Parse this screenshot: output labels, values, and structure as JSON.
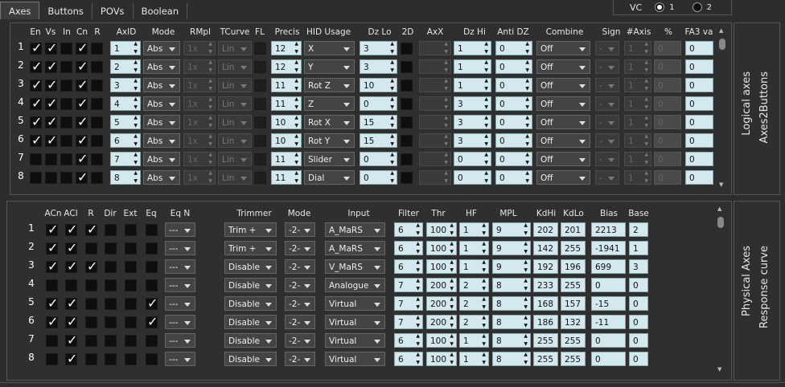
{
  "tabs": [
    "Axes",
    "Buttons",
    "POVs",
    "Boolean"
  ],
  "vc": {
    "label": "VC",
    "opt1": "1",
    "opt2": "2"
  },
  "side": {
    "top_a": "Logical axes",
    "top_b": "Axes2Buttons",
    "bot_a": "Physical Axes",
    "bot_b": "Response curve"
  },
  "logical": {
    "headers": [
      "En",
      "Vs",
      "In",
      "Cn",
      "R",
      "AxID",
      "Mode",
      "RMpl",
      "TCurve",
      "FL",
      "Precis",
      "HID Usage",
      "Dz Lo",
      "2D",
      "AxX",
      "Dz Hi",
      "Anti DZ",
      "Combine",
      "Sign",
      "#Axis",
      "%",
      "FA3 va"
    ],
    "rows": [
      {
        "n": "1",
        "en": 1,
        "vs": 1,
        "in": 0,
        "cn": 1,
        "r": 0,
        "axid": "1",
        "mode": "Abs",
        "rmpl": "1x",
        "tcurve": "Lin",
        "precis": "12",
        "hid": "X",
        "dzlo": "3",
        "dzhi": "1",
        "antidz": "0",
        "combine": "Off",
        "sign": "-",
        "naxis": "1",
        "pct": "0",
        "fa3": "0"
      },
      {
        "n": "2",
        "en": 1,
        "vs": 1,
        "in": 0,
        "cn": 1,
        "r": 0,
        "axid": "2",
        "mode": "Abs",
        "rmpl": "1x",
        "tcurve": "Lin",
        "precis": "12",
        "hid": "Y",
        "dzlo": "3",
        "dzhi": "1",
        "antidz": "0",
        "combine": "Off",
        "sign": "-",
        "naxis": "1",
        "pct": "0",
        "fa3": "0"
      },
      {
        "n": "3",
        "en": 1,
        "vs": 1,
        "in": 0,
        "cn": 1,
        "r": 0,
        "axid": "3",
        "mode": "Abs",
        "rmpl": "1x",
        "tcurve": "Lin",
        "precis": "11",
        "hid": "Rot Z",
        "dzlo": "10",
        "dzhi": "1",
        "antidz": "0",
        "combine": "Off",
        "sign": "-",
        "naxis": "1",
        "pct": "0",
        "fa3": "0"
      },
      {
        "n": "4",
        "en": 1,
        "vs": 1,
        "in": 0,
        "cn": 1,
        "r": 0,
        "axid": "4",
        "mode": "Abs",
        "rmpl": "1x",
        "tcurve": "Lin",
        "precis": "11",
        "hid": "Z",
        "dzlo": "0",
        "dzhi": "3",
        "antidz": "0",
        "combine": "Off",
        "sign": "-",
        "naxis": "1",
        "pct": "0",
        "fa3": "0"
      },
      {
        "n": "5",
        "en": 1,
        "vs": 1,
        "in": 0,
        "cn": 1,
        "r": 0,
        "axid": "5",
        "mode": "Abs",
        "rmpl": "1x",
        "tcurve": "Lin",
        "precis": "10",
        "hid": "Rot X",
        "dzlo": "15",
        "dzhi": "3",
        "antidz": "0",
        "combine": "Off",
        "sign": "-",
        "naxis": "1",
        "pct": "0",
        "fa3": "0"
      },
      {
        "n": "6",
        "en": 1,
        "vs": 1,
        "in": 0,
        "cn": 1,
        "r": 0,
        "axid": "6",
        "mode": "Abs",
        "rmpl": "1x",
        "tcurve": "Lin",
        "precis": "10",
        "hid": "Rot Y",
        "dzlo": "15",
        "dzhi": "3",
        "antidz": "0",
        "combine": "Off",
        "sign": "-",
        "naxis": "1",
        "pct": "0",
        "fa3": "0"
      },
      {
        "n": "7",
        "en": 0,
        "vs": 0,
        "in": 0,
        "cn": 1,
        "r": 0,
        "axid": "7",
        "mode": "Abs",
        "rmpl": "1x",
        "tcurve": "Lin",
        "precis": "11",
        "hid": "Slider",
        "dzlo": "0",
        "dzhi": "0",
        "antidz": "0",
        "combine": "Off",
        "sign": "-",
        "naxis": "1",
        "pct": "0",
        "fa3": "0"
      },
      {
        "n": "8",
        "en": 0,
        "vs": 0,
        "in": 0,
        "cn": 1,
        "r": 0,
        "axid": "8",
        "mode": "Abs",
        "rmpl": "1x",
        "tcurve": "Lin",
        "precis": "11",
        "hid": "Dial",
        "dzlo": "0",
        "dzhi": "0",
        "antidz": "0",
        "combine": "Off",
        "sign": "-",
        "naxis": "1",
        "pct": "0",
        "fa3": "0"
      }
    ]
  },
  "physical": {
    "headers": [
      "ACn",
      "ACl",
      "R",
      "Dir",
      "Ext",
      "Eq",
      "Eq N",
      "Trimmer",
      "Mode",
      "Input",
      "Filter",
      "Thr",
      "HF",
      "MPL",
      "KdHi",
      "KdLo",
      "Bias",
      "Base"
    ],
    "rows": [
      {
        "n": "1",
        "acn": 1,
        "acl": 1,
        "r": 1,
        "dir": 0,
        "ext": 0,
        "eq": 0,
        "eqn": "---",
        "trim": "Trim +",
        "mode": "-2-",
        "input": "A_MaRS",
        "filter": "6",
        "thr": "100",
        "hf": "1",
        "mpl": "9",
        "kdhi": "202",
        "kdlo": "201",
        "bias": "2213",
        "base": "2"
      },
      {
        "n": "2",
        "acn": 1,
        "acl": 1,
        "r": 0,
        "dir": 0,
        "ext": 0,
        "eq": 0,
        "eqn": "---",
        "trim": "Trim +",
        "mode": "-2-",
        "input": "A_MaRS",
        "filter": "6",
        "thr": "100",
        "hf": "1",
        "mpl": "9",
        "kdhi": "142",
        "kdlo": "255",
        "bias": "-1941",
        "base": "1"
      },
      {
        "n": "3",
        "acn": 1,
        "acl": 1,
        "r": 1,
        "dir": 0,
        "ext": 0,
        "eq": 0,
        "eqn": "---",
        "trim": "Disable",
        "mode": "-2-",
        "input": "V_MaRS",
        "filter": "6",
        "thr": "100",
        "hf": "1",
        "mpl": "9",
        "kdhi": "192",
        "kdlo": "196",
        "bias": "699",
        "base": "3"
      },
      {
        "n": "4",
        "acn": 0,
        "acl": 0,
        "r": 0,
        "dir": 0,
        "ext": 0,
        "eq": 0,
        "eqn": "---",
        "trim": "Disable",
        "mode": "-2-",
        "input": "Analogue",
        "filter": "7",
        "thr": "200",
        "hf": "2",
        "mpl": "8",
        "kdhi": "233",
        "kdlo": "255",
        "bias": "0",
        "base": "0"
      },
      {
        "n": "5",
        "acn": 1,
        "acl": 1,
        "r": 0,
        "dir": 0,
        "ext": 0,
        "eq": 1,
        "eqn": "---",
        "trim": "Disable",
        "mode": "-2-",
        "input": "Virtual",
        "filter": "7",
        "thr": "200",
        "hf": "2",
        "mpl": "8",
        "kdhi": "168",
        "kdlo": "157",
        "bias": "-15",
        "base": "0"
      },
      {
        "n": "6",
        "acn": 1,
        "acl": 1,
        "r": 0,
        "dir": 0,
        "ext": 0,
        "eq": 1,
        "eqn": "---",
        "trim": "Disable",
        "mode": "-2-",
        "input": "Virtual",
        "filter": "7",
        "thr": "200",
        "hf": "2",
        "mpl": "8",
        "kdhi": "186",
        "kdlo": "132",
        "bias": "-11",
        "base": "0"
      },
      {
        "n": "7",
        "acn": 0,
        "acl": 1,
        "r": 0,
        "dir": 0,
        "ext": 0,
        "eq": 0,
        "eqn": "---",
        "trim": "Disable",
        "mode": "-2-",
        "input": "Virtual",
        "filter": "6",
        "thr": "100",
        "hf": "1",
        "mpl": "8",
        "kdhi": "255",
        "kdlo": "255",
        "bias": "0",
        "base": "0"
      },
      {
        "n": "8",
        "acn": 0,
        "acl": 1,
        "r": 0,
        "dir": 0,
        "ext": 0,
        "eq": 0,
        "eqn": "---",
        "trim": "Disable",
        "mode": "-2-",
        "input": "Virtual",
        "filter": "6",
        "thr": "100",
        "hf": "1",
        "mpl": "8",
        "kdhi": "255",
        "kdlo": "255",
        "bias": "0",
        "base": "0"
      }
    ]
  }
}
